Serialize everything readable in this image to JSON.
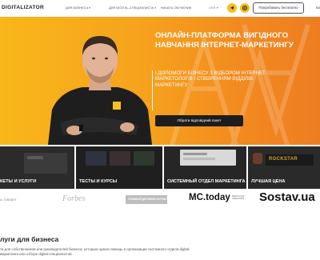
{
  "header": {
    "logo": "DIGITALIZATOR",
    "nav": [
      {
        "label": "ДЛЯ БИЗНЕСА",
        "has_caret": true
      },
      {
        "label": "ДЛЯ DIGITAL-СПЕЦИАЛИСТА",
        "has_caret": true
      },
      {
        "label": "НАЧАТЬ ОБУЧЕНИЕ",
        "has_caret": false
      }
    ],
    "lang": "UKR",
    "lang_caret": "▾",
    "caret": "▾",
    "social_icons": [
      "telegram-icon",
      "instagram-icon"
    ],
    "try_button": "Попробовать бесплатно",
    "cut_text": "ВХ"
  },
  "hero": {
    "title": "ОНЛАЙН-ПЛАТФОРМА ВИГІДНОГО НАВЧАННЯ ІНТЕРНЕТ-МАРКЕТИНГУ",
    "subtitle": "І ДОПОМОГИ БІЗНЕСУ З ВІДБОРОМ ІНТЕРНЕТ-МАРКЕТОЛОГІВ І СТВОРЕННЯМ ВІДДІЛІВ МАРКЕТИНГУ",
    "button": "Обрати відповідний пакет",
    "colors": {
      "start": "#f8b71a",
      "end": "#ee7d22"
    }
  },
  "tiles": [
    {
      "label": "КЕТЫ И УСЛУГИ"
    },
    {
      "label": "ТЕСТЫ И КУРСЫ"
    },
    {
      "label": ""
    },
    {
      "label": "СИСТЕМНЫЙ ОТДЕЛ МАРКЕТИНГА"
    },
    {
      "label": "ЛУЧШАЯ ЦЕНА",
      "badge": "ROCKSTAR"
    }
  ],
  "partners": [
    {
      "name": "ы говорят"
    },
    {
      "name": "Forbes"
    },
    {
      "name": "ГЛАВНЫЙ ДЕЛОВОЙ ЖУРНАЛ"
    },
    {
      "name": "MC.today",
      "tag": "MEDIA FOR CREATORS"
    },
    {
      "name": "Sostav.ua"
    }
  ],
  "services": {
    "title": "луги для бизнеса",
    "desc": "ти для собственников или руководителей бизнеса, которым нужна помощь в организации системного отдела digital-маркетинга или отборе digital-специалистов"
  }
}
